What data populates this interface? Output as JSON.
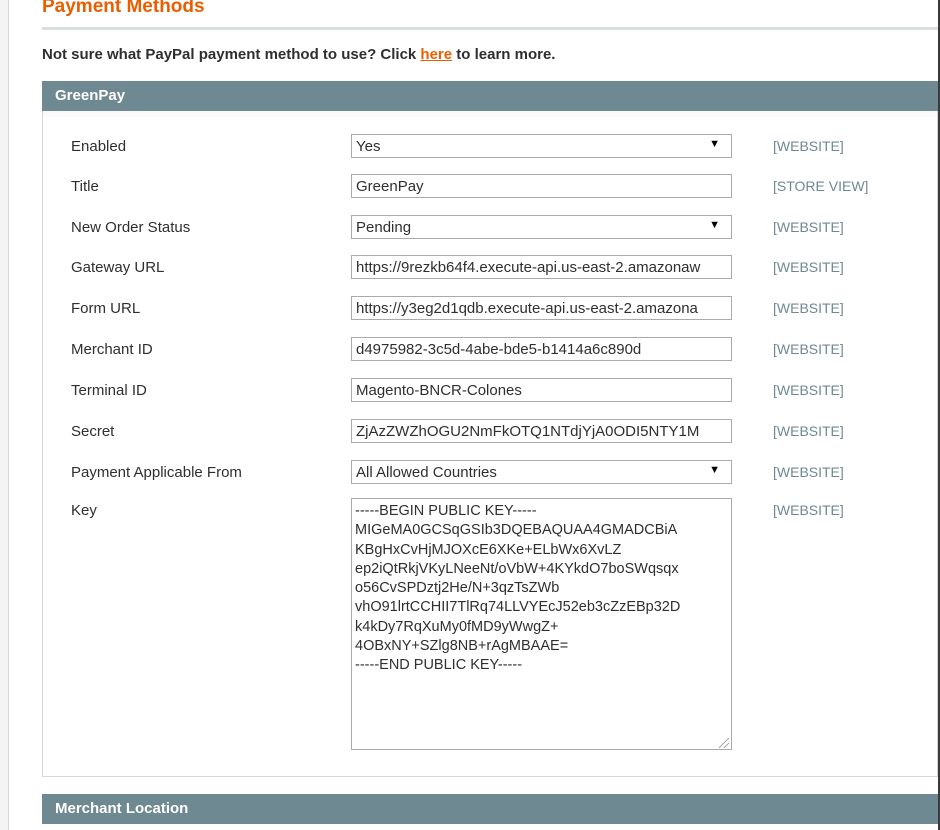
{
  "page": {
    "title": "Payment Methods",
    "hint_text_before": "Not sure what PayPal payment method to use? Click ",
    "hint_link": "here",
    "hint_text_after": " to learn more."
  },
  "greenpay": {
    "header": "GreenPay",
    "fields": {
      "enabled": {
        "label": "Enabled",
        "value": "Yes",
        "scope": "[WEBSITE]"
      },
      "title": {
        "label": "Title",
        "value": "GreenPay",
        "scope": "[STORE VIEW]"
      },
      "new_order_status": {
        "label": "New Order Status",
        "value": "Pending",
        "scope": "[WEBSITE]"
      },
      "gateway_url": {
        "label": "Gateway URL",
        "value": "https://9rezkb64f4.execute-api.us-east-2.amazonaw",
        "scope": "[WEBSITE]"
      },
      "form_url": {
        "label": "Form URL",
        "value": "https://y3eg2d1qdb.execute-api.us-east-2.amazona",
        "scope": "[WEBSITE]"
      },
      "merchant_id": {
        "label": "Merchant ID",
        "value": "d4975982-3c5d-4abe-bde5-b1414a6c890d",
        "scope": "[WEBSITE]"
      },
      "terminal_id": {
        "label": "Terminal ID",
        "value": "Magento-BNCR-Colones",
        "scope": "[WEBSITE]"
      },
      "secret": {
        "label": "Secret",
        "value": "ZjAzZWZhOGU2NmFkOTQ1NTdjYjA0ODI5NTY1M",
        "scope": "[WEBSITE]"
      },
      "payment_applicable_from": {
        "label": "Payment Applicable From",
        "value": "All Allowed Countries",
        "scope": "[WEBSITE]"
      },
      "key": {
        "label": "Key",
        "value": "-----BEGIN PUBLIC KEY-----\nMIGeMA0GCSqGSIb3DQEBAQUAA4GMADCBiA\nKBgHxCvHjMJOXcE6XKe+ELbWx6XvLZ\nep2iQtRkjVKyLNeeNt/oVbW+4KYkdO7boSWqsqx\no56CvSPDztj2He/N+3qzTsZWb\nvhO91lrtCCHII7TlRq74LLVYEcJ52eb3cZzEBp32D\nk4kDy7RqXuMy0fMD9yWwgZ+\n4OBxNY+SZlg8NB+rAgMBAAE=\n-----END PUBLIC KEY-----",
        "scope": "[WEBSITE]"
      }
    }
  },
  "merchant_location": {
    "header": "Merchant Location"
  },
  "icons": {
    "select_arrow": "▼"
  }
}
